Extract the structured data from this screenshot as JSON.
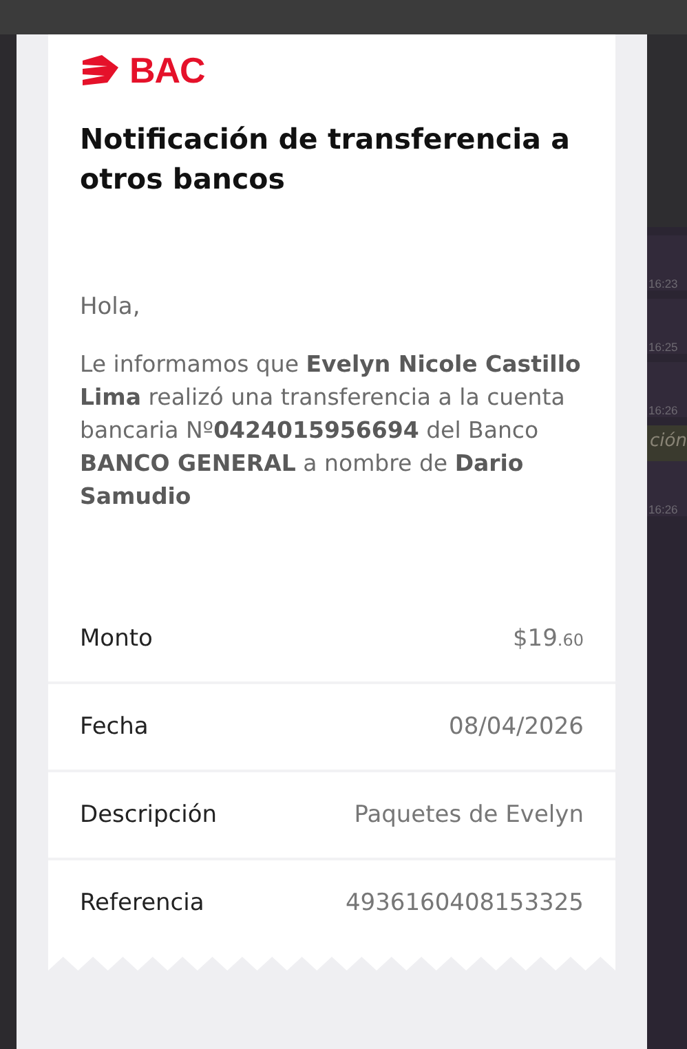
{
  "background": {
    "times": [
      {
        "text": "16:23",
        "kind": "time"
      },
      {
        "text": "16:25",
        "kind": "time"
      },
      {
        "text": "16:26",
        "kind": "time"
      },
      {
        "text": "ción",
        "kind": "note"
      },
      {
        "text": "16:26",
        "kind": "time"
      }
    ]
  },
  "logo": {
    "text": "BAC"
  },
  "title": "Notificación de transferencia a otros bancos",
  "greeting": "Hola,",
  "message": "Le informamos que **Evelyn Nicole Castillo Lima** realizó una transferencia a la cuenta bancaria Nº**0424015956694** del Banco **BANCO GENERAL** a nombre de **Dario Samudio**",
  "details": [
    {
      "label": "Monto",
      "value": "$19",
      "value_small": ".60"
    },
    {
      "label": "Fecha",
      "value": "08/04/2026"
    },
    {
      "label": "Descripción",
      "value": "Paquetes de Evelyn"
    },
    {
      "label": "Referencia",
      "value": "4936160408153325"
    }
  ]
}
